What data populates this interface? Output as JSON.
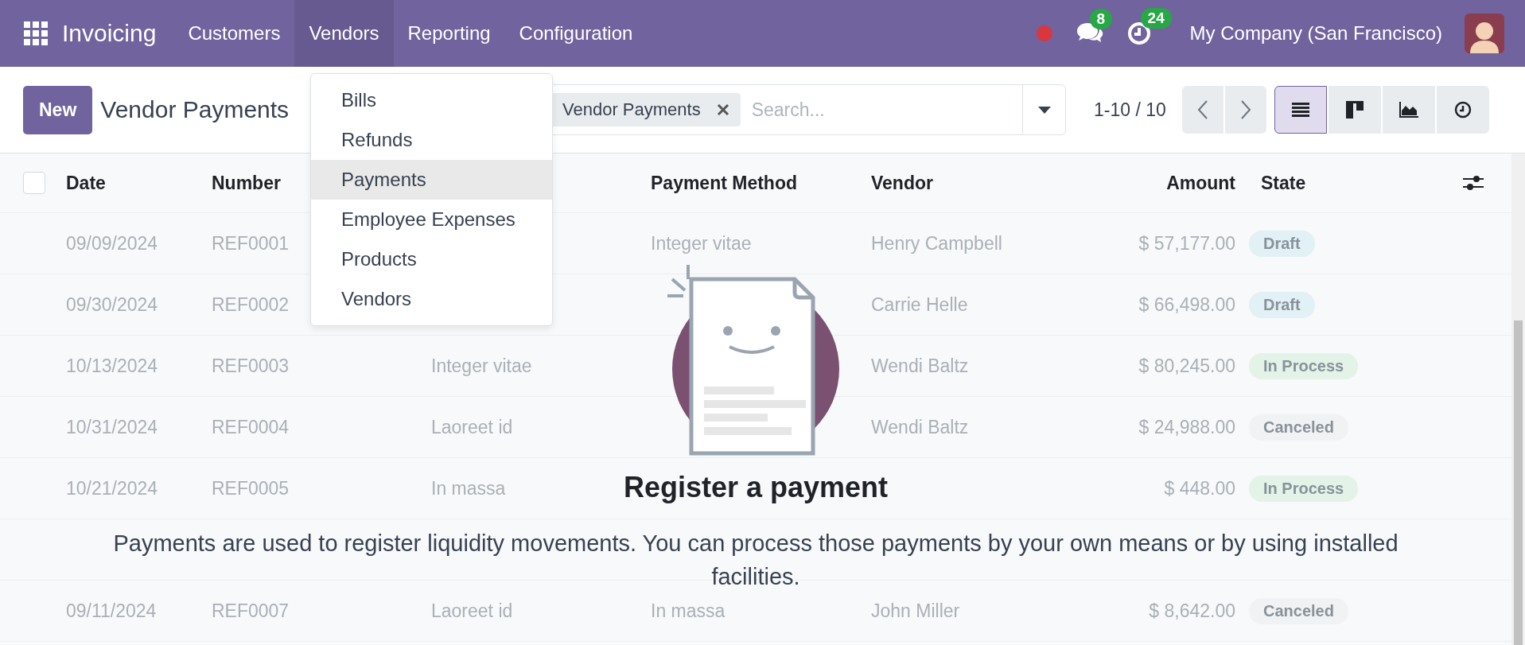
{
  "navbar": {
    "app_name": "Invoicing",
    "menu": [
      {
        "label": "Customers",
        "selected": false
      },
      {
        "label": "Vendors",
        "selected": true
      },
      {
        "label": "Reporting",
        "selected": false
      },
      {
        "label": "Configuration",
        "selected": false
      }
    ],
    "message_count": "8",
    "activity_count": "24",
    "company": "My Company (San Francisco)"
  },
  "vendors_menu": [
    {
      "label": "Bills",
      "selected": false
    },
    {
      "label": "Refunds",
      "selected": false
    },
    {
      "label": "Payments",
      "selected": true
    },
    {
      "label": "Employee Expenses",
      "selected": false
    },
    {
      "label": "Products",
      "selected": false
    },
    {
      "label": "Vendors",
      "selected": false
    }
  ],
  "control_panel": {
    "new_button": "New",
    "title": "Vendor Payments",
    "facet": "Vendor Payments",
    "search_placeholder": "Search...",
    "pager": "1-10 / 10",
    "views": [
      {
        "kind": "list",
        "selected": true
      },
      {
        "kind": "kanban",
        "selected": false
      },
      {
        "kind": "graph",
        "selected": false
      },
      {
        "kind": "activity",
        "selected": false
      }
    ]
  },
  "table": {
    "select_all_checked": false,
    "columns": {
      "date": "Date",
      "number": "Number",
      "payment_method": "Payment Method",
      "vendor": "Vendor",
      "amount": "Amount",
      "state": "State"
    },
    "rows": [
      {
        "date": "09/09/2024",
        "number": "REF0001",
        "payment_method": "Integer vitae",
        "vendor": "Henry Campbell",
        "amount": "$ 57,177.00",
        "state": {
          "label": "Draft",
          "color": "#e2f1f5"
        }
      },
      {
        "date": "09/30/2024",
        "number": "REF0002",
        "vendor": "Carrie Helle",
        "amount": "$ 66,498.00",
        "state": {
          "label": "Draft",
          "color": "#e2f1f5"
        }
      },
      {
        "date": "10/13/2024",
        "number": "REF0003",
        "column_3": "Integer vitae",
        "vendor": "Wendi Baltz",
        "amount": "$ 80,245.00",
        "state": {
          "label": "In Process",
          "color": "#e3f3e8"
        }
      },
      {
        "date": "10/31/2024",
        "number": "REF0004",
        "column_3": "Laoreet id",
        "vendor": "Wendi Baltz",
        "amount": "$ 24,988.00",
        "state": {
          "label": "Canceled",
          "color": "#f1f2f3"
        }
      },
      {
        "date": "10/21/2024",
        "number": "REF0005",
        "column_3": "In massa",
        "amount": "$ 448.00",
        "state": {
          "label": "In Process",
          "color": "#e3f3e8"
        }
      },
      {},
      {
        "date": "09/11/2024",
        "number": "REF0007",
        "column_3": "Laoreet id",
        "payment_method": "In massa",
        "vendor": "John Miller",
        "amount": "$ 8,642.00",
        "state": {
          "label": "Canceled",
          "color": "#f1f2f3"
        }
      }
    ]
  },
  "empty_state": {
    "title": "Register a payment",
    "description": "Payments are used to register liquidity movements. You can process those payments by your own means or by using installed facilities."
  }
}
